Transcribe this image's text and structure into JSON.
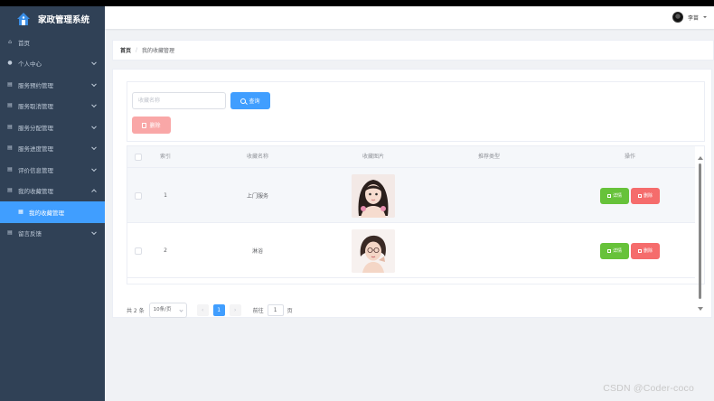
{
  "app": {
    "title": "家政管理系统"
  },
  "sidebar": {
    "items": [
      {
        "label": "首页",
        "icon": "home-icon",
        "expandable": false
      },
      {
        "label": "个人中心",
        "icon": "user-icon",
        "expandable": true
      },
      {
        "label": "服务预约管理",
        "icon": "menu-icon",
        "expandable": true
      },
      {
        "label": "服务取消管理",
        "icon": "menu-icon",
        "expandable": true
      },
      {
        "label": "服务分配管理",
        "icon": "menu-icon",
        "expandable": true
      },
      {
        "label": "服务进度管理",
        "icon": "menu-icon",
        "expandable": true
      },
      {
        "label": "评价信息管理",
        "icon": "menu-icon",
        "expandable": true
      },
      {
        "label": "我的收藏管理",
        "icon": "menu-icon",
        "expandable": true,
        "expanded": true
      },
      {
        "label": "留言反馈",
        "icon": "menu-icon",
        "expandable": true
      }
    ],
    "submenu": [
      {
        "label": "我的收藏管理",
        "icon": "document-icon",
        "active": true
      }
    ]
  },
  "header": {
    "username": "李苗"
  },
  "breadcrumb": {
    "home": "首页",
    "separator": "/",
    "current": "我的收藏管理"
  },
  "search": {
    "placeholder": "收藏名称",
    "search_button": "查询",
    "batch_delete_button": "删除"
  },
  "table": {
    "headers": [
      "索引",
      "收藏名称",
      "收藏图片",
      "推荐类型",
      "操作"
    ],
    "rows": [
      {
        "index": "1",
        "name": "上门服务",
        "type": "",
        "detail": "详情",
        "delete": "删除"
      },
      {
        "index": "2",
        "name": "淋浴",
        "type": "",
        "detail": "详情",
        "delete": "删除"
      }
    ]
  },
  "pagination": {
    "total": "共 2 条",
    "page_size": "10条/页",
    "prev": "‹",
    "current_page": "1",
    "next": "›",
    "goto_label": "前往",
    "goto_value": "1",
    "page_suffix": "页"
  },
  "watermark": "CSDN @Coder-coco",
  "colors": {
    "sidebar": "#304156",
    "primary": "#409eff",
    "success": "#67c23a",
    "danger": "#f56c6c"
  }
}
